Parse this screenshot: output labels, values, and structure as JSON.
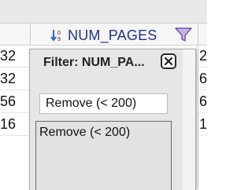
{
  "header": {
    "column_title": "NUM_PAGES",
    "sort_icon": "sort-numeric-icon",
    "filter_icon": "funnel-icon"
  },
  "rows": {
    "left": [
      "32",
      "32",
      "56",
      "16"
    ],
    "right": [
      "2",
      "6",
      "6",
      "1"
    ]
  },
  "filter_popup": {
    "title": "Filter: NUM_PA...",
    "close_icon": "close-icon",
    "input_value": "Remove (< 200)",
    "options": [
      "Remove (< 200)"
    ]
  },
  "colors": {
    "header_text": "#20348c",
    "sort_blue": "#2a64c9",
    "funnel_fill": "#c9b4e8",
    "popup_bg": "#e6e6e6"
  }
}
